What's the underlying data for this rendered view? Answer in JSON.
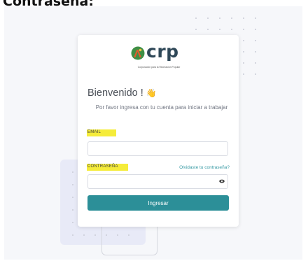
{
  "page": {
    "heading": "Contraseña:"
  },
  "brand": {
    "name": "crp",
    "tagline": "Corporación para la Recreación Popular",
    "colors": {
      "primary": "#2c8f98",
      "logo_green": "#3f8f45",
      "logo_orange": "#e35a2c",
      "highlight": "#f5ec3a"
    }
  },
  "login": {
    "welcome": "Bienvenido !",
    "welcome_emoji": "👋",
    "subtitle": "Por favor ingresa con tu cuenta para iniciar a trabajar",
    "email_label": "EMAIL",
    "email_value": "",
    "password_label": "CONTRASEÑA",
    "password_value": "",
    "forgot_link": "Olvidaste tu contraseña?",
    "submit_label": "Ingresar",
    "icons": {
      "password_toggle": "eye-icon",
      "logo": "crp-logo-icon"
    }
  }
}
